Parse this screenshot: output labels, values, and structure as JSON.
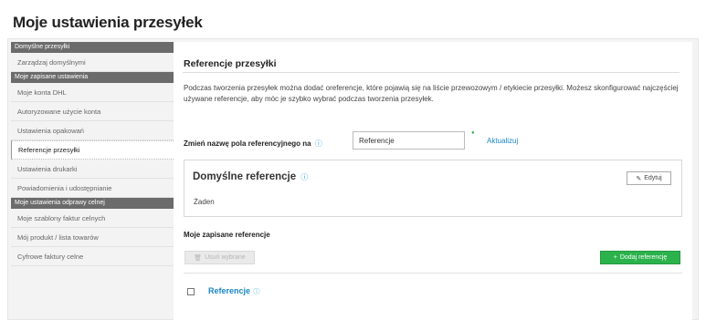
{
  "page": {
    "title": "Moje ustawienia przesyłek"
  },
  "sidebar": {
    "groups": [
      {
        "header": "Domyślne przesyłki",
        "items": [
          "Zarządzaj domyślnymi"
        ]
      },
      {
        "header": "Moje zapisane ustawienia",
        "items": [
          "Moje konta DHL",
          "Autoryzowane użycie konta",
          "Ustawienia opakowań",
          "Referencje przesyłki",
          "Ustawienia drukarki",
          "Powiadomienia i udostępnianie"
        ]
      },
      {
        "header": "Moje ustawienia odprawy celnej",
        "items": [
          "Moje szablony faktur celnych",
          "Mój produkt / lista towarów",
          "Cyfrowe faktury celne"
        ]
      }
    ],
    "active_item": "Referencje przesyłki"
  },
  "main": {
    "section_title": "Referencje przesyłki",
    "description": "Podczas tworzenia przesyłek można dodać oreferencje, które pojawią się na liście przewozowym / etykiecie przesyłki. Możesz skonfigurować najczęściej używane referencje, aby móc je szybko wybrać podczas tworzenia przesyłek.",
    "rename": {
      "label": "Zmień nazwę pola referencyjnego na",
      "info_icon": "ⓘ",
      "input_value": "Referencje",
      "update_label": "Aktualizuj"
    },
    "default_card": {
      "title": "Domyślne referencje",
      "info_icon": "ⓘ",
      "edit_label": "Edytuj",
      "value": "Żaden"
    },
    "saved": {
      "title": "Moje zapisane referencje",
      "remove_label": "Usuń wybrane",
      "add_label": "Dodaj referencję",
      "rows": [
        {
          "label": "Referencje",
          "checked": false
        }
      ]
    }
  },
  "colors": {
    "accent_green": "#2bb24c",
    "link_blue": "#1a86c8",
    "sidebar_header": "#6b6b6b"
  },
  "icons": {
    "info": "info-icon",
    "edit": "edit-icon",
    "remove": "trash-icon",
    "add": "plus-icon"
  }
}
